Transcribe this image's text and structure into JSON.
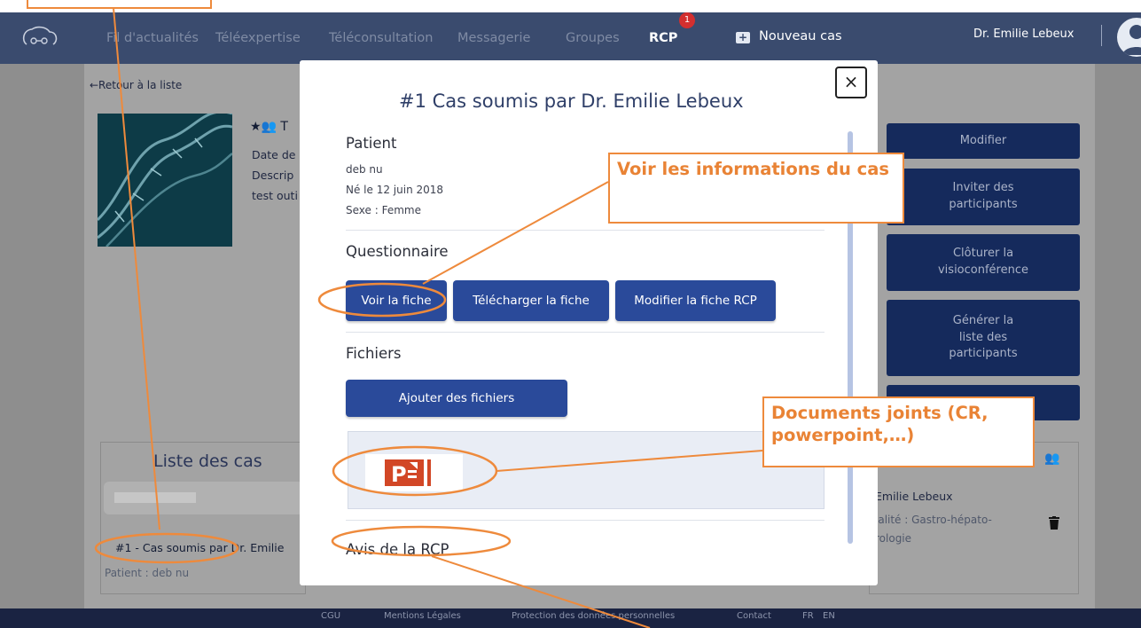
{
  "nav": {
    "items": [
      "Fil d'actualités",
      "Téléexpertise",
      "Téléconsultation",
      "Messagerie",
      "Groupes",
      "RCP"
    ],
    "rcp_badge": "1",
    "new_case": "Nouveau cas",
    "user": "Dr. Emilie Lebeux"
  },
  "page": {
    "back": "←Retour à la liste",
    "date_label": "Date de",
    "desc_label": "Descrip",
    "desc_value": "test outi",
    "side_buttons": [
      "Modifier",
      "Inviter des participants",
      "Clôturer la visioconférence",
      "Générer la liste des participants"
    ],
    "case_list_title": "Liste des cas",
    "case_item": "#1 - Cas soumis par Dr. Emilie",
    "case_patient": "Patient : deb nu",
    "participant_name": "Emilie Lebeux",
    "participant_spec": "ialité : Gastro-hépato-",
    "participant_spec2": "rologie"
  },
  "footer": {
    "links": [
      "CGU",
      "Mentions Légales",
      "Protection des données personnelles",
      "Contact",
      "FR",
      "EN"
    ]
  },
  "modal": {
    "title": "#1 Cas soumis par Dr. Emilie Lebeux",
    "close": "×",
    "patient": {
      "heading": "Patient",
      "name": "deb nu",
      "born": "Né le 12 juin 2018",
      "sex": "Sexe : Femme"
    },
    "questionnaire": {
      "heading": "Questionnaire",
      "buttons": [
        "Voir la fiche",
        "Télécharger la fiche",
        "Modifier la fiche RCP"
      ]
    },
    "files": {
      "heading": "Fichiers",
      "add": "Ajouter des fichiers"
    },
    "avis_heading": "Avis de la RCP"
  },
  "annotations": {
    "view_info": "Voir les informations du cas",
    "attachments": "Documents joints (CR, powerpoint,…)"
  },
  "colors": {
    "accent": "#2a4a9a",
    "callout": "#ee8a3c",
    "topbar": "#3a4b6e"
  }
}
